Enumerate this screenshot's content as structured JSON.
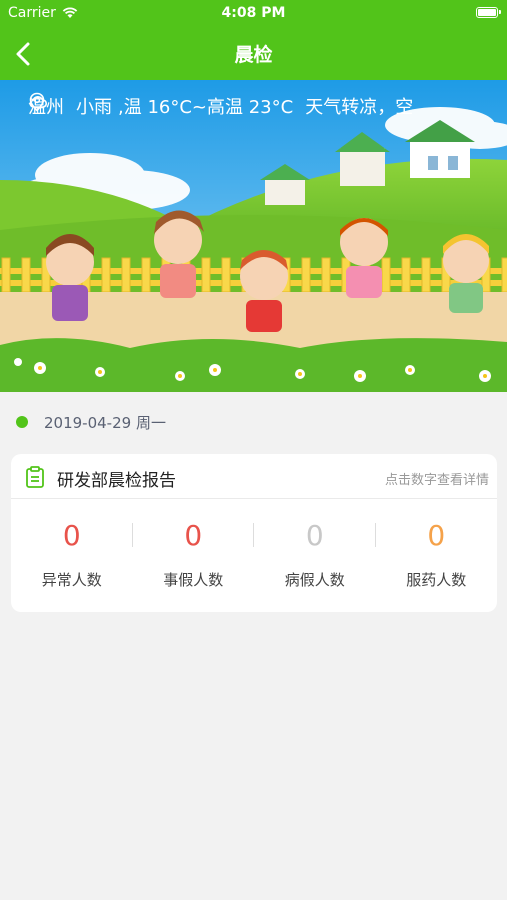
{
  "status_bar": {
    "carrier": "Carrier",
    "time": "4:08 PM"
  },
  "nav": {
    "title": "晨检"
  },
  "weather": {
    "city": "温州",
    "condition": "小雨",
    "temp_text": ",温 16°C~高温 23°C",
    "tip": "天气转凉，空"
  },
  "date": {
    "text": "2019-04-29 周一"
  },
  "report": {
    "title": "研发部晨检报告",
    "hint": "点击数字查看详情",
    "stats": [
      {
        "value": "0",
        "label": "异常人数",
        "color": "#e8534b"
      },
      {
        "value": "0",
        "label": "事假人数",
        "color": "#e8534b"
      },
      {
        "value": "0",
        "label": "病假人数",
        "color": "#c8c8c8"
      },
      {
        "value": "0",
        "label": "服药人数",
        "color": "#f5a24a"
      }
    ]
  },
  "colors": {
    "brand_green": "#52c41a",
    "background": "#f2f2f2"
  }
}
